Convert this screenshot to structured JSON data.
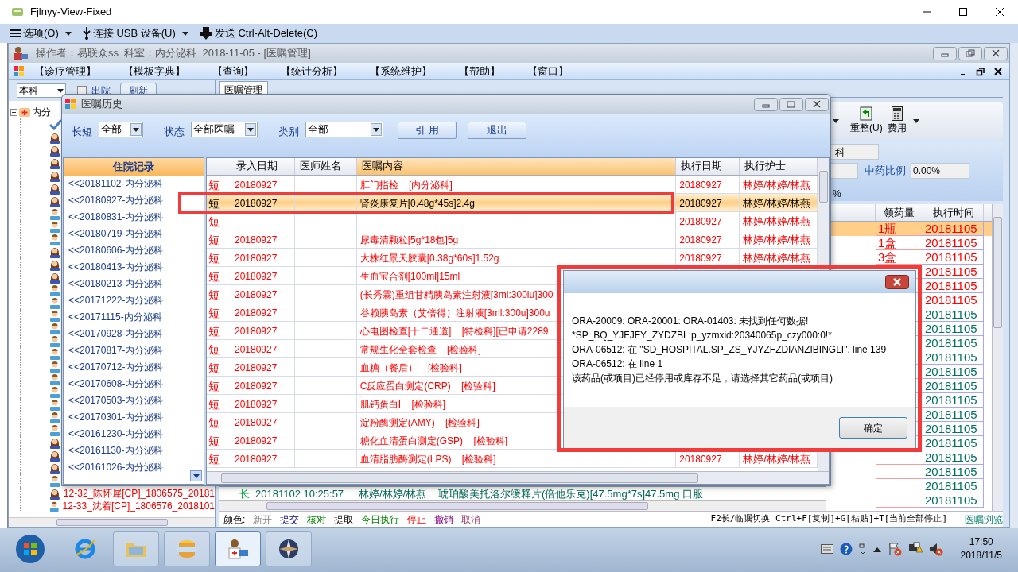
{
  "window": {
    "title": "Fjlnyy-View-Fixed"
  },
  "toolbar": [
    {
      "kind": "menu",
      "label": "选项(O)"
    },
    {
      "kind": "usb",
      "label": "连接 USB 设备(U)"
    },
    {
      "kind": "send",
      "label": "发送 Ctrl-Alt-Delete(C)"
    }
  ],
  "app": {
    "title": "操作者：易联众ss  科室：内分泌科  2018-11-05 - [医嘱管理]",
    "menu": [
      "【诊疗管理】",
      "【模板字典】",
      "【查询】",
      "【统计分析】",
      "【系统维护】",
      "【帮助】",
      "【窗口】"
    ]
  },
  "left_panel": {
    "scope": "本科",
    "discharged": {
      "label": "出院",
      "checked": false
    },
    "refresh": "刷新",
    "root": "内分",
    "patients": [
      {
        "kind": "check"
      },
      {
        "kind": "female"
      },
      {
        "kind": "female"
      },
      {
        "kind": "female"
      },
      {
        "kind": "female"
      },
      {
        "kind": "female"
      },
      {
        "kind": "female"
      },
      {
        "kind": "male"
      },
      {
        "kind": "male"
      },
      {
        "kind": "male"
      },
      {
        "kind": "female"
      },
      {
        "kind": "female"
      },
      {
        "kind": "female"
      },
      {
        "kind": "male"
      },
      {
        "kind": "male"
      },
      {
        "kind": "male"
      },
      {
        "kind": "male"
      },
      {
        "kind": "male"
      },
      {
        "kind": "male"
      },
      {
        "kind": "male"
      },
      {
        "kind": "male"
      },
      {
        "kind": "male"
      },
      {
        "kind": "male"
      },
      {
        "kind": "male"
      },
      {
        "kind": "male"
      },
      {
        "kind": "female"
      },
      {
        "kind": "female"
      },
      {
        "kind": "female"
      },
      {
        "kind": "male"
      },
      {
        "kind": "female",
        "label": "12-32_陈怀犀[CP]_1806575_20181"
      },
      {
        "kind": "male",
        "label": "12-33_沈着[CP]_1806576_2018101"
      }
    ]
  },
  "main": {
    "tab": {
      "label": "医嘱管理",
      "selected": true
    },
    "tools": [
      {
        "kind": "reorg",
        "label": "重整(U)"
      },
      {
        "kind": "fee",
        "label": "费用"
      }
    ],
    "field_1": "科",
    "ratio_label": "中药比例",
    "ratio": "0.00%",
    "field_3": "%",
    "columns": [
      "领药量",
      "执行时间"
    ],
    "rows": [
      {
        "quantity": "1瓶",
        "time": "20181105",
        "kind": "alert",
        "selected": true
      },
      {
        "quantity": "1盒",
        "time": "20181105",
        "kind": "alert",
        "selected": false
      },
      {
        "quantity": "3盒",
        "time": "20181105",
        "kind": "alert",
        "selected": false
      },
      {
        "time": "20181105",
        "kind": "alert",
        "selected": false
      },
      {
        "time": "20181105",
        "kind": "alert",
        "selected": false
      },
      {
        "time": "20181105",
        "kind": "alert",
        "selected": false
      },
      {
        "time": "20181105",
        "kind": "normal",
        "selected": false
      },
      {
        "time": "20181105",
        "kind": "normal",
        "selected": false
      },
      {
        "time": "20181105",
        "kind": "normal",
        "selected": false
      },
      {
        "time": "20181105",
        "kind": "normal",
        "selected": false
      },
      {
        "time": "20181105",
        "kind": "normal",
        "selected": false
      },
      {
        "time": "20181105",
        "kind": "normal",
        "selected": false
      },
      {
        "time": "20181105",
        "kind": "normal",
        "selected": false
      },
      {
        "time": "20181105",
        "kind": "normal",
        "selected": false
      },
      {
        "time": "20181105",
        "kind": "normal",
        "selected": false
      },
      {
        "time": "20181105",
        "kind": "normal",
        "selected": false
      },
      {
        "time": "20181105",
        "kind": "normal",
        "selected": false
      },
      {
        "time": "20181105",
        "kind": "normal",
        "selected": false
      },
      {
        "time": "20181105",
        "kind": "normal",
        "selected": false
      },
      {
        "time": "20181105",
        "kind": "normal",
        "selected": false
      }
    ],
    "lower_row": {
      "mark": "长",
      "time": "20181102 10:25:57",
      "nurse": "林婷/林婷/林燕",
      "content": "琥珀酸美托洛尔缓释片(倍他乐克)[47.5mg*7s]47.5mg 口服"
    },
    "legend_label": "颜色:",
    "legend": [
      {
        "label": "新开",
        "kind": "new"
      },
      {
        "label": "提交",
        "kind": "submitted"
      },
      {
        "label": "核对",
        "kind": "checked"
      },
      {
        "label": "提取",
        "kind": "extracted"
      },
      {
        "label": "今日执行",
        "kind": "today"
      },
      {
        "label": "停止",
        "kind": "stopped"
      },
      {
        "label": "撤销",
        "kind": "revoked"
      },
      {
        "label": "取消",
        "kind": "cancelled"
      }
    ],
    "hint": "F2长/临嘱切换 Ctrl+F[复制]+G[粘贴]+T[当前全部停止]",
    "browse": "医嘱浏览"
  },
  "history": {
    "title": "医嘱历史",
    "filters": [
      {
        "label": "长短",
        "value": "全部"
      },
      {
        "label": "状态",
        "value": "全部医嘱"
      },
      {
        "label": "类别",
        "value": "全部"
      }
    ],
    "buttons": [
      "引 用",
      "退出"
    ],
    "records_title": "住院记录",
    "records": [
      "<<20181102-内分泌科",
      "<<20180927-内分泌科",
      "<<20180831-内分泌科",
      "<<20180719-内分泌科",
      "<<20180606-内分泌科",
      "<<20180413-内分泌科",
      "<<20180213-内分泌科",
      "<<20171222-内分泌科",
      "<<20171115-内分泌科",
      "<<20170928-内分泌科",
      "<<20170817-内分泌科",
      "<<20170712-内分泌科",
      "<<20170608-内分泌科",
      "<<20170503-内分泌科",
      "<<20170301-内分泌科",
      "<<20161230-内分泌科",
      "<<20161130-内分泌科",
      "<<20161026-内分泌科"
    ],
    "columns": [
      "录入日期",
      "医师姓名",
      "医嘱内容",
      "执行日期",
      "执行护士"
    ],
    "rows": [
      {
        "type": "短",
        "date": "20180927",
        "content": "肛门指检    [内分泌科]",
        "exec_date": "20180927",
        "nurse": "林婷/林婷/林燕",
        "selected": false
      },
      {
        "type": "短",
        "date": "20180927",
        "content": "肾炎康复片[0.48g*45s]2.4g",
        "exec_date": "20180927",
        "nurse": "林婷/林婷/林燕",
        "selected": true
      },
      {
        "type": "短",
        "exec_date": "20180927",
        "nurse": "林婷/林婷/林燕",
        "selected": false
      },
      {
        "type": "短",
        "date": "20180927",
        "content": "尿毒清颗粒[5g*18包]5g",
        "exec_date": "20180927",
        "nurse": "林婷/林婷/林燕",
        "selected": false
      },
      {
        "type": "短",
        "date": "20180927",
        "content": "大株红景天胶囊[0.38g*60s]1.52g",
        "exec_date": "20180927",
        "nurse": "林婷/林婷/林燕",
        "selected": false
      },
      {
        "type": "短",
        "date": "20180927",
        "content": "生血宝合剂[100ml]15ml",
        "selected": false
      },
      {
        "type": "短",
        "date": "20180927",
        "content": "(长秀霖)重组甘精胰岛素注射液[3ml:300iu]300",
        "selected": false
      },
      {
        "type": "短",
        "date": "20180927",
        "content": "谷赖胰岛素（艾倍得）注射液[3ml:300u]300u",
        "selected": false
      },
      {
        "type": "短",
        "date": "20180927",
        "content": "心电图检查[十二通道]    [特检科][已申请2289",
        "selected": false
      },
      {
        "type": "短",
        "date": "20180927",
        "content": "常规生化全套检查    [检验科]",
        "selected": false
      },
      {
        "type": "短",
        "date": "20180927",
        "content": "血糖（餐后）    [检验科]",
        "selected": false
      },
      {
        "type": "短",
        "date": "20180927",
        "content": "C反应蛋白测定(CRP)    [检验科]",
        "selected": false
      },
      {
        "type": "短",
        "date": "20180927",
        "content": "肌钙蛋白I    [检验科]",
        "selected": false
      },
      {
        "type": "短",
        "date": "20180927",
        "content": "淀粉酶测定(AMY)    [检验科]",
        "selected": false
      },
      {
        "type": "短",
        "date": "20180927",
        "content": "糖化血清蛋白测定(GSP)    [检验科]",
        "selected": false
      },
      {
        "type": "短",
        "date": "20180927",
        "content": "血清脂肪酶测定(LPS)    [检验科]",
        "exec_date": "20180927",
        "nurse": "林婷/林婷/林燕",
        "selected": false
      }
    ]
  },
  "error_dialog": {
    "lines": [
      "ORA-20009: ORA-20001: ORA-01403: 未找到任何数据!",
      "*SP_BQ_YJFJFY_ZYDZBL:p_yzmxid:20340065p_czy000:0!*",
      "ORA-06512: 在 \"SD_HOSPITAL.SP_ZS_YJYZFZDIANZIBINGLI\", line 139",
      "ORA-06512: 在 line 1",
      "该药品(或项目)已经停用或库存不足，请选择其它药品(或项目)"
    ],
    "button": "确定"
  },
  "taskbar": {
    "apps": [
      {
        "kind": "browser",
        "active": false
      },
      {
        "kind": "folder",
        "active": false
      },
      {
        "kind": "database",
        "active": false
      },
      {
        "kind": "doctor",
        "active": true
      },
      {
        "kind": "compass",
        "active": false
      }
    ],
    "time": "17:50",
    "date": "2018/11/5"
  }
}
